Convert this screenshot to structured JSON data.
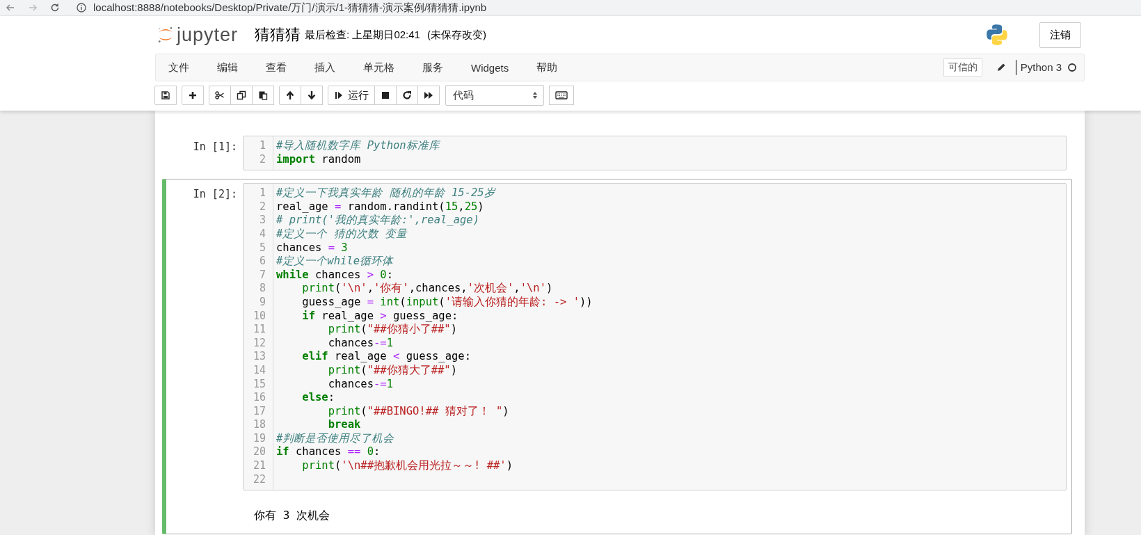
{
  "browser": {
    "url": "localhost:8888/notebooks/Desktop/Private/万门/演示/1-猜猜猜-演示案例/猜猜猜.ipynb"
  },
  "header": {
    "logo_text": "jupyter",
    "title": "猜猜猜",
    "checkpoint": "最后检查: 上星期日02:41",
    "save_status": "(未保存改变)",
    "logout": "注销"
  },
  "menu": [
    "文件",
    "编辑",
    "查看",
    "插入",
    "单元格",
    "服务",
    "Widgets",
    "帮助"
  ],
  "kernel": {
    "trusted": "可信的",
    "name": "Python 3",
    "busy": false
  },
  "toolbar": {
    "groups": [
      [
        {
          "kind": "save"
        }
      ],
      [
        {
          "kind": "add"
        }
      ],
      [
        {
          "kind": "cut"
        },
        {
          "kind": "copy"
        },
        {
          "kind": "paste"
        }
      ],
      [
        {
          "kind": "up"
        },
        {
          "kind": "down"
        }
      ],
      [
        {
          "kind": "run",
          "label": "运行"
        },
        {
          "kind": "stop"
        },
        {
          "kind": "restart"
        },
        {
          "kind": "fast-forward"
        }
      ]
    ],
    "cell_type": "代码"
  },
  "cells": [
    {
      "prompt": "In [1]:",
      "selected": false,
      "lines": [
        {
          "number": "1",
          "tokens": [
            {
              "kind": "comment",
              "text": "#导入随机数字库 Python标准库"
            }
          ]
        },
        {
          "number": "2",
          "tokens": [
            {
              "kind": "keyword",
              "text": "import"
            },
            {
              "kind": "plain",
              "text": " random"
            }
          ]
        }
      ]
    },
    {
      "prompt": "In [2]:",
      "selected": true,
      "lines": [
        {
          "number": "1",
          "tokens": [
            {
              "kind": "comment",
              "text": "#定义一下我真实年龄 随机的年龄 15-25岁"
            }
          ]
        },
        {
          "number": "2",
          "tokens": [
            {
              "kind": "plain",
              "text": "real_age "
            },
            {
              "kind": "operator",
              "text": "="
            },
            {
              "kind": "plain",
              "text": " random.randint("
            },
            {
              "kind": "number",
              "text": "15"
            },
            {
              "kind": "plain",
              "text": ","
            },
            {
              "kind": "number",
              "text": "25"
            },
            {
              "kind": "plain",
              "text": ")"
            }
          ]
        },
        {
          "number": "3",
          "tokens": [
            {
              "kind": "comment",
              "text": "# print('我的真实年龄:',real_age)"
            }
          ]
        },
        {
          "number": "4",
          "tokens": [
            {
              "kind": "comment",
              "text": "#定义一个 猜的次数 变量"
            }
          ]
        },
        {
          "number": "5",
          "tokens": [
            {
              "kind": "plain",
              "text": "chances "
            },
            {
              "kind": "operator",
              "text": "="
            },
            {
              "kind": "number",
              "text": " 3"
            }
          ]
        },
        {
          "number": "6",
          "tokens": [
            {
              "kind": "comment",
              "text": "#定义一个while循环体"
            }
          ]
        },
        {
          "number": "7",
          "tokens": [
            {
              "kind": "keyword",
              "text": "while"
            },
            {
              "kind": "plain",
              "text": " chances "
            },
            {
              "kind": "operator",
              "text": ">"
            },
            {
              "kind": "number",
              "text": " 0"
            },
            {
              "kind": "plain",
              "text": ":"
            }
          ]
        },
        {
          "number": "8",
          "tokens": [
            {
              "kind": "builtin",
              "text": "    print"
            },
            {
              "kind": "plain",
              "text": "("
            },
            {
              "kind": "string",
              "text": "'\\n'"
            },
            {
              "kind": "plain",
              "text": ","
            },
            {
              "kind": "string",
              "text": "'你有'"
            },
            {
              "kind": "plain",
              "text": ",chances,"
            },
            {
              "kind": "string",
              "text": "'次机会'"
            },
            {
              "kind": "plain",
              "text": ","
            },
            {
              "kind": "string",
              "text": "'\\n'"
            },
            {
              "kind": "plain",
              "text": ")"
            }
          ]
        },
        {
          "number": "9",
          "tokens": [
            {
              "kind": "plain",
              "text": "    guess_age "
            },
            {
              "kind": "operator",
              "text": "="
            },
            {
              "kind": "builtin",
              "text": " int"
            },
            {
              "kind": "plain",
              "text": "("
            },
            {
              "kind": "builtin",
              "text": "input"
            },
            {
              "kind": "plain",
              "text": "("
            },
            {
              "kind": "string",
              "text": "'请输入你猜的年龄: -> '"
            },
            {
              "kind": "plain",
              "text": "))"
            }
          ]
        },
        {
          "number": "10",
          "tokens": [
            {
              "kind": "keyword",
              "text": "    if"
            },
            {
              "kind": "plain",
              "text": " real_age "
            },
            {
              "kind": "operator",
              "text": ">"
            },
            {
              "kind": "plain",
              "text": " guess_age:"
            }
          ]
        },
        {
          "number": "11",
          "tokens": [
            {
              "kind": "builtin",
              "text": "        print"
            },
            {
              "kind": "plain",
              "text": "("
            },
            {
              "kind": "string",
              "text": "\"##你猜小了##\""
            },
            {
              "kind": "plain",
              "text": ")"
            }
          ]
        },
        {
          "number": "12",
          "tokens": [
            {
              "kind": "plain",
              "text": "        chances"
            },
            {
              "kind": "operator",
              "text": "-="
            },
            {
              "kind": "number",
              "text": "1"
            }
          ]
        },
        {
          "number": "13",
          "tokens": [
            {
              "kind": "keyword",
              "text": "    elif"
            },
            {
              "kind": "plain",
              "text": " real_age "
            },
            {
              "kind": "operator",
              "text": "<"
            },
            {
              "kind": "plain",
              "text": " guess_age:"
            }
          ]
        },
        {
          "number": "14",
          "tokens": [
            {
              "kind": "builtin",
              "text": "        print"
            },
            {
              "kind": "plain",
              "text": "("
            },
            {
              "kind": "string",
              "text": "\"##你猜大了##\""
            },
            {
              "kind": "plain",
              "text": ")"
            }
          ]
        },
        {
          "number": "15",
          "tokens": [
            {
              "kind": "plain",
              "text": "        chances"
            },
            {
              "kind": "operator",
              "text": "-="
            },
            {
              "kind": "number",
              "text": "1"
            }
          ]
        },
        {
          "number": "16",
          "tokens": [
            {
              "kind": "keyword",
              "text": "    else"
            },
            {
              "kind": "plain",
              "text": ":"
            }
          ]
        },
        {
          "number": "17",
          "tokens": [
            {
              "kind": "builtin",
              "text": "        print"
            },
            {
              "kind": "plain",
              "text": "("
            },
            {
              "kind": "string",
              "text": "\"##BINGO!## 猜对了！ \""
            },
            {
              "kind": "plain",
              "text": ")"
            }
          ]
        },
        {
          "number": "18",
          "tokens": [
            {
              "kind": "keyword",
              "text": "        break"
            }
          ]
        },
        {
          "number": "19",
          "tokens": [
            {
              "kind": "comment",
              "text": "#判断是否使用尽了机会"
            }
          ]
        },
        {
          "number": "20",
          "tokens": [
            {
              "kind": "keyword",
              "text": "if"
            },
            {
              "kind": "plain",
              "text": " chances "
            },
            {
              "kind": "operator",
              "text": "=="
            },
            {
              "kind": "number",
              "text": " 0"
            },
            {
              "kind": "plain",
              "text": ":"
            }
          ]
        },
        {
          "number": "21",
          "tokens": [
            {
              "kind": "builtin",
              "text": "    print"
            },
            {
              "kind": "plain",
              "text": "("
            },
            {
              "kind": "string",
              "text": "'\\n##抱歉机会用光拉～～! ##'"
            },
            {
              "kind": "plain",
              "text": ")"
            }
          ]
        },
        {
          "number": "22"
        }
      ],
      "output": "你有 3 次机会"
    }
  ]
}
